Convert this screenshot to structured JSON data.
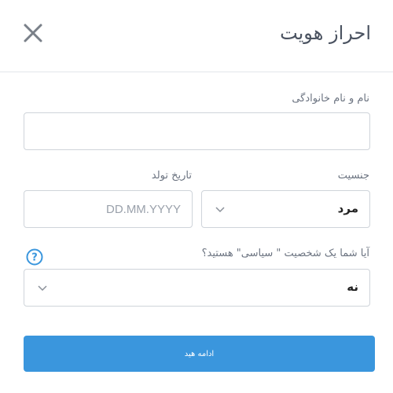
{
  "header": {
    "title": "احراز هویت",
    "close_icon": "close-icon"
  },
  "form": {
    "name": {
      "label": "نام و نام خانوادگی",
      "value": "",
      "placeholder": ""
    },
    "gender": {
      "label": "جنسیت",
      "value": "مرد",
      "icon": "chevron-down-icon"
    },
    "birth_date": {
      "label": "تاریخ تولد",
      "value": "",
      "placeholder": "DD.MM.YYYY"
    },
    "pep": {
      "label": "آیا شما یک شخصیت \" سیاسی\" هستید؟",
      "value": "نه",
      "icon": "chevron-down-icon",
      "help_icon": "question-circle-icon"
    }
  },
  "actions": {
    "continue_label": "ادامه هید"
  },
  "colors": {
    "accent": "#3a96dd",
    "border": "#cfd4da",
    "text": "#4b5361"
  }
}
